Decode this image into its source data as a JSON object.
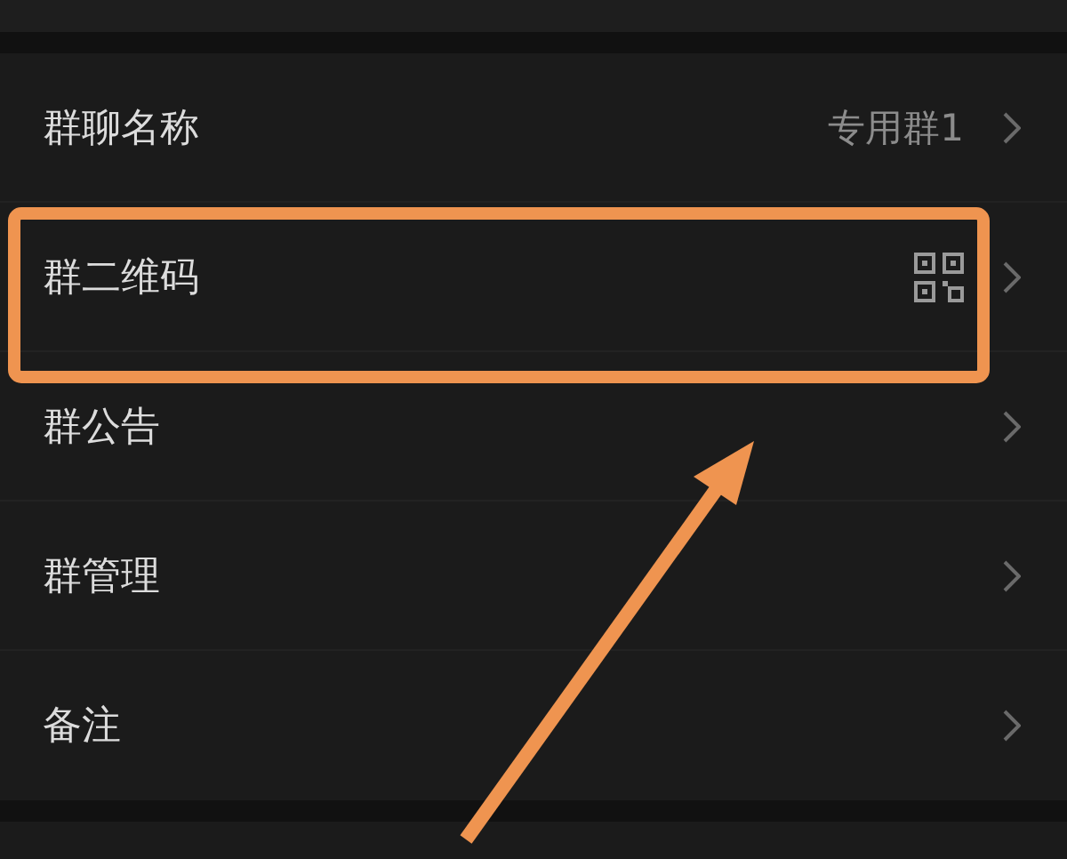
{
  "settings_items": [
    {
      "kind": "value",
      "label": "群聊名称",
      "value": "专用群1"
    },
    {
      "kind": "qrcode",
      "label": "群二维码"
    },
    {
      "kind": "plain",
      "label": "群公告"
    },
    {
      "kind": "plain",
      "label": "群管理"
    },
    {
      "kind": "plain",
      "label": "备注"
    }
  ]
}
